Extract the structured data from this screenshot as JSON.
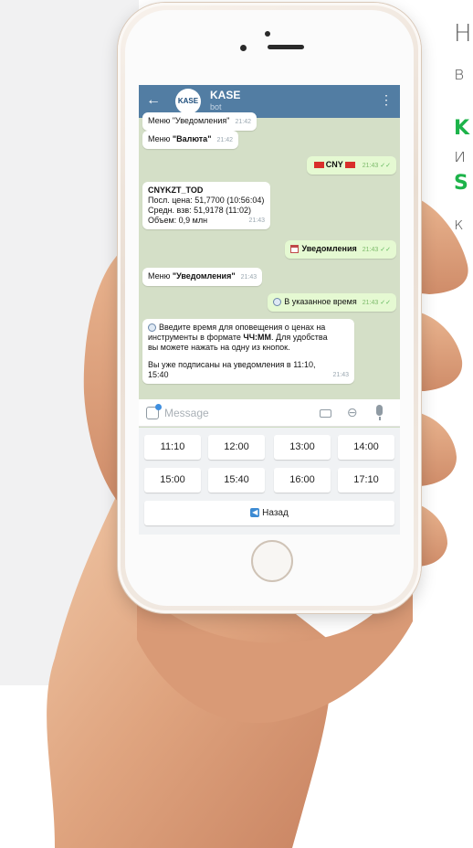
{
  "side_text": [
    {
      "text": "Н",
      "green": false
    },
    {
      "text": "в",
      "green": false
    },
    {
      "text": "K",
      "green": true
    },
    {
      "text": "и",
      "green": false
    },
    {
      "text": "S",
      "green": true
    },
    {
      "text": "к",
      "green": false
    }
  ],
  "chat": {
    "avatar_text": "KASE",
    "title": "KASE",
    "subtitle": "bot",
    "messages": {
      "m0": {
        "text": "Меню \"Уведомления\"",
        "time": "21:42"
      },
      "m1": {
        "prefix": "Меню ",
        "bold": "\"Валюта\"",
        "time": "21:42"
      },
      "m2": {
        "text": "CNY",
        "time": "21:43"
      },
      "m3": {
        "title": "CNYKZT_TOD",
        "lines": [
          "Посл. цена: 51,7700 (10:56:04)",
          "Средн. взв: 51,9178 (11:02)",
          "Объем: 0,9 млн"
        ],
        "time": "21:43"
      },
      "m4": {
        "text": "Уведомления",
        "time": "21:43"
      },
      "m5": {
        "prefix": "Меню ",
        "bold": "\"Уведомления\"",
        "time": "21:43"
      },
      "m6": {
        "text": "В указанное время",
        "time": "21:43"
      },
      "m7": {
        "line1": "Введите время для оповещения о ценах на",
        "line2_prefix": "инструменты в формате ",
        "line2_bold": "ЧЧ:ММ",
        "line2_suffix": ". Для удобства",
        "line3": "вы можете нажать на одну из кнопок.",
        "line4": "Вы уже подписаны на уведомления в 11:10,",
        "line5": "15:40",
        "time": "21:43"
      }
    },
    "input": {
      "placeholder": "Message",
      "value": ""
    },
    "keyboard": {
      "row1": [
        "11:10",
        "12:00",
        "13:00",
        "14:00"
      ],
      "row2": [
        "15:00",
        "15:40",
        "16:00",
        "17:10"
      ],
      "back": "Назад"
    }
  },
  "colors": {
    "header": "#527da3",
    "accent_green": "#1db34a",
    "outgoing_bubble": "#e5f9d2"
  }
}
